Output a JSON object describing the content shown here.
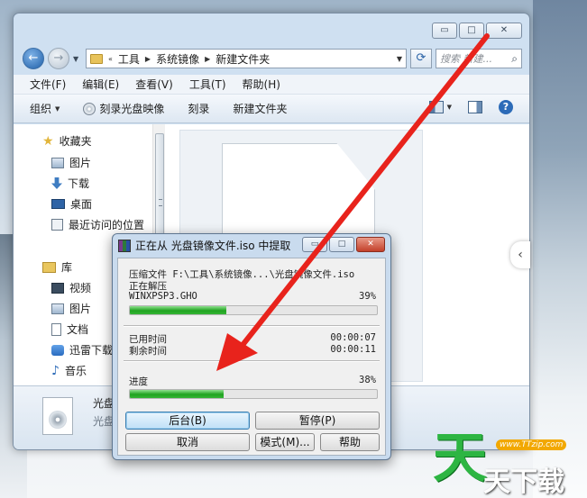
{
  "explorer": {
    "caption_buttons": {
      "minimize": "▭",
      "maximize": "□",
      "close": "✕"
    },
    "nav": {
      "back": "←",
      "forward": "→"
    },
    "breadcrumb": [
      "工具",
      "系统镜像",
      "新建文件夹"
    ],
    "search_placeholder": "搜索 新建...",
    "menu": [
      "文件(F)",
      "编辑(E)",
      "查看(V)",
      "工具(T)",
      "帮助(H)"
    ],
    "toolbar": {
      "organize": "组织",
      "burn_image": "刻录光盘映像",
      "burn": "刻录",
      "new_folder": "新建文件夹",
      "help": "?"
    },
    "nav_pane": {
      "favorites": "收藏夹",
      "fav_items": [
        "图片",
        "下载",
        "桌面",
        "最近访问的位置"
      ],
      "libraries": "库",
      "lib_items": [
        "视频",
        "图片",
        "文档",
        "迅雷下载",
        "音乐"
      ]
    },
    "details": {
      "name": "光盘",
      "type": "光盘"
    }
  },
  "dialog": {
    "title": "正在从 光盘镜像文件.iso 中提取",
    "compress_label": "压缩文件 F:\\工具\\系统镜像...\\光盘镜像文件.iso",
    "status": "正在解压",
    "current_file": "WINXPSP3.GHO",
    "file_percent": "39%",
    "file_progress": 0.39,
    "elapsed_label": "已用时间",
    "elapsed": "00:00:07",
    "remaining_label": "剩余时间",
    "remaining": "00:00:11",
    "progress_label": "进度",
    "total_percent": "38%",
    "total_progress": 0.38,
    "buttons": {
      "background": "后台(B)",
      "pause": "暂停(P)",
      "cancel": "取消",
      "mode": "模式(M)...",
      "help": "帮助"
    }
  },
  "watermark": {
    "url": "www.TTzip.com",
    "brand_big": "天",
    "brand_mid": "天下载"
  },
  "colors": {
    "arrow": "#e8231c",
    "progress": "#2aa52a"
  }
}
